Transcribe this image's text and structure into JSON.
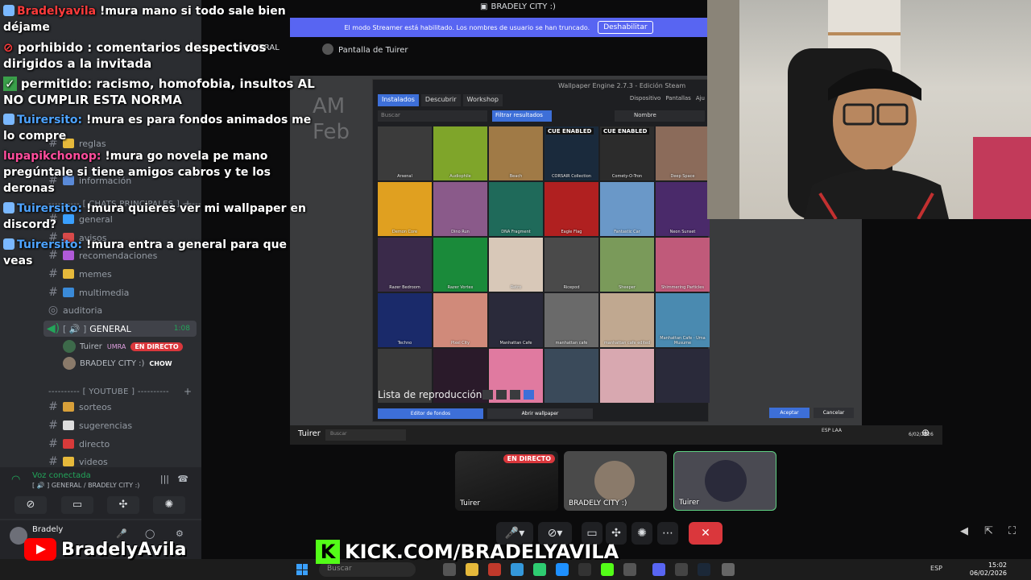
{
  "window": {
    "stream_title": "BRADELY CITY :)"
  },
  "streamer_mode": {
    "message": "El modo Streamer está habilitado. Los nombres de usuario se han truncado.",
    "button": "Deshabilitar"
  },
  "voice_header": {
    "channel": "GENERAL",
    "screen_share": "Pantalla de Tuirer"
  },
  "sidebar": {
    "sections": [
      {
        "label": "---------- [ CHATS PRINCIPALES ] ----------"
      },
      {
        "label": "---------- [ YOUTUBE ] ----------"
      }
    ],
    "channels_top": [
      {
        "label": "reglas"
      },
      {
        "label": "información"
      }
    ],
    "channels_main": [
      {
        "label": "general"
      },
      {
        "label": "avisos"
      },
      {
        "label": "recomendaciones"
      },
      {
        "label": "memes"
      },
      {
        "label": "multimedia"
      }
    ],
    "voice_channels": [
      {
        "label": "auditoria"
      },
      {
        "label": "GENERAL",
        "time": "1:08"
      }
    ],
    "voice_users": [
      {
        "name": "Tuirer",
        "tag": "UMRA",
        "badge": "EN DIRECTO"
      },
      {
        "name": "BRADELY CITY :)",
        "tag": "CHOW"
      }
    ],
    "youtube_channels": [
      {
        "label": "sorteos"
      },
      {
        "label": "sugerencias"
      },
      {
        "label": "directo"
      },
      {
        "label": "videos"
      }
    ],
    "voice_status": {
      "title": "Voz conectada",
      "subtitle": "[ 🔊 ] GENERAL / BRADELY CITY :)"
    },
    "user": {
      "name": "Bradely"
    }
  },
  "chat": [
    {
      "user": "Bradelyavila",
      "text": "!mura mano si todo sale bien déjame"
    },
    {
      "user": "",
      "text": "porhibido : comentarios despectivos dirigidos a la invitada"
    },
    {
      "user": "",
      "text": "permitido: racismo, homofobia, insultos AL NO CUMPLIR ESTA NORMA"
    },
    {
      "user": "Tuirersito:",
      "text": "!mura es para fondos animados me lo compre"
    },
    {
      "user": "lupapikchonop:",
      "text": "!mura go novela pe mano pregúntale si tiene amigos cabros y te los deronas"
    },
    {
      "user": "Tuirersito:",
      "text": "!mura quieres ver mi wallpaper en discord?"
    },
    {
      "user": "Tuirersito:",
      "text": "!mura entra a general para que veas"
    }
  ],
  "screen_bg": {
    "line1": "AM",
    "line2": "Feb"
  },
  "wallpaper_engine": {
    "title": "Wallpaper Engine 2.7.3 - Edición Steam",
    "tabs": [
      "Instalados",
      "Descubrir",
      "Workshop"
    ],
    "right_tabs": [
      "Dispositivo",
      "Pantallas",
      "Aju"
    ],
    "search_placeholder": "Buscar",
    "filter": "Filtrar resultados",
    "sort": "Nombre",
    "tiles": [
      {
        "name": "Arsenal",
        "color": "#3b3b3b"
      },
      {
        "name": "Audiophile",
        "color": "#7fa52a"
      },
      {
        "name": "Beach",
        "color": "#a07a46"
      },
      {
        "name": "CORSAIR Collection",
        "color": "#1a2a3c",
        "cue": "CUE ENABLED"
      },
      {
        "name": "Comety-O-Tron",
        "color": "#2c2c2c",
        "cue": "CUE ENABLED"
      },
      {
        "name": "Deep Space",
        "color": "#8b6b5a"
      },
      {
        "name": "Demon Core",
        "color": "#e0a020"
      },
      {
        "name": "Dino Run",
        "color": "#8a5a8a"
      },
      {
        "name": "DNA Fragment",
        "color": "#1f6a5a"
      },
      {
        "name": "Eagle Flag",
        "color": "#b02020"
      },
      {
        "name": "Fantastic Car",
        "color": "#6a98c8"
      },
      {
        "name": "Neon Sunset",
        "color": "#4a2a6a"
      },
      {
        "name": "Razer Bedroom",
        "color": "#3a2a4a"
      },
      {
        "name": "Razer Vortex",
        "color": "#1a8a3a"
      },
      {
        "name": "Retro",
        "color": "#d8c8b8"
      },
      {
        "name": "Ricepod",
        "color": "#4a4a4a"
      },
      {
        "name": "Sheeper",
        "color": "#7a9a5a"
      },
      {
        "name": "Shimmering Particles",
        "color": "#c05a7a"
      },
      {
        "name": "Techno",
        "color": "#1a2a6a"
      },
      {
        "name": "Pixel City",
        "color": "#d08a7a"
      },
      {
        "name": "Manhattan Cafe",
        "color": "#2a2a3a"
      },
      {
        "name": "manhattan cafe",
        "color": "#6a6a6a"
      },
      {
        "name": "manhattan cafe edited",
        "color": "#c0a890"
      },
      {
        "name": "Manhattan Cafe - Uma Musume",
        "color": "#4a8ab0"
      },
      {
        "name": "",
        "color": "#3a3a3a"
      },
      {
        "name": "",
        "color": "#2a1a2a"
      },
      {
        "name": "",
        "color": "#e07aa0"
      },
      {
        "name": "",
        "color": "#3a4a5a"
      },
      {
        "name": "",
        "color": "#d8a8b0"
      },
      {
        "name": "",
        "color": "#2a2a3a"
      }
    ],
    "playlist": "Lista de reproducción",
    "editor_button": "Editor de fondos",
    "open_button": "Abrir wallpaper",
    "accept_button": "Aceptar",
    "cancel_button": "Cancelar"
  },
  "screen_taskbar": {
    "user": "Tuirer",
    "search": "Buscar",
    "lang": "ESP LAA",
    "date": "6/02/2026"
  },
  "video_tiles": [
    {
      "name": "Tuirer",
      "badge": "EN DIRECTO"
    },
    {
      "name": "BRADELY CITY :)"
    },
    {
      "name": "Tuirer"
    }
  ],
  "overlays": {
    "youtube": "BradelyAvila",
    "kick": "KICK.COM/BRADELYAVILA"
  },
  "taskbar": {
    "search": "Buscar",
    "lang": "ESP",
    "time": "15:02",
    "date": "06/02/2026"
  }
}
